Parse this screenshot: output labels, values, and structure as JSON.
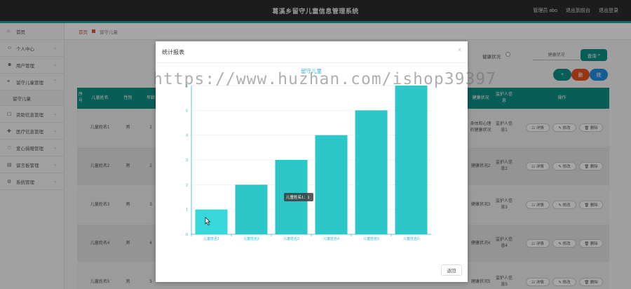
{
  "app": {
    "title": "葛溪乡留守儿童信息管理系统",
    "admin_label": "管理员 abo",
    "back_to_front": "退出到前台",
    "logout": "退出登录"
  },
  "sidebar": {
    "items": [
      {
        "label": "首页",
        "icon": "home-icon"
      },
      {
        "label": "个人中心",
        "icon": "user-icon"
      },
      {
        "label": "用户管理",
        "icon": "users-icon"
      },
      {
        "label": "留守儿童管理",
        "icon": "list-icon"
      },
      {
        "label": "留守儿童"
      },
      {
        "label": "资助信息管理",
        "icon": "doc-icon"
      },
      {
        "label": "医疗信息管理",
        "icon": "medical-icon"
      },
      {
        "label": "爱心捐赠管理",
        "icon": "heart-icon"
      },
      {
        "label": "留言板管理",
        "icon": "message-icon"
      },
      {
        "label": "系统管理",
        "icon": "gear-icon"
      }
    ]
  },
  "breadcrumb": {
    "home": "首页",
    "current": "留守儿童"
  },
  "search": {
    "label": "健康状况",
    "placeholder": "健康状况",
    "button": "查询"
  },
  "actions": {
    "add": "+",
    "delete": "删",
    "chart": "统"
  },
  "table": {
    "headers": [
      "序号",
      "儿童姓名",
      "性别",
      "年龄",
      "健康状况",
      "监护人信息",
      "操作"
    ],
    "rows": [
      {
        "index": "",
        "name": "儿童姓名1",
        "gender": "男",
        "age": "1",
        "health": "身体和心理的健康状况",
        "guardian": "监护人信息1"
      },
      {
        "index": "",
        "name": "儿童姓名2",
        "gender": "男",
        "age": "2",
        "health": "健康状况2",
        "guardian": "监护人信息2"
      },
      {
        "index": "",
        "name": "儿童姓名3",
        "gender": "男",
        "age": "3",
        "health": "健康状况3",
        "guardian": "监护人信息3"
      },
      {
        "index": "",
        "name": "儿童姓名4",
        "gender": "男",
        "age": "4",
        "health": "健康状况4",
        "guardian": "监护人信息4"
      },
      {
        "index": "",
        "name": "儿童姓名5",
        "gender": "男",
        "age": "5",
        "health": "健康状况5",
        "guardian": "监护人信息5"
      }
    ],
    "row_buttons": {
      "detail": "☷ 详情",
      "edit": "✎ 修改",
      "delete": "🗑 删除"
    }
  },
  "modal": {
    "title": "统计报表",
    "close": "×",
    "back_button": "返回"
  },
  "chart_data": {
    "type": "bar",
    "title": "留守儿童",
    "categories": [
      "儿童姓名1",
      "儿童姓名2",
      "儿童姓名3",
      "儿童姓名4",
      "儿童姓名5",
      "儿童姓名6"
    ],
    "values": [
      1,
      2,
      3,
      4,
      5,
      6
    ],
    "ylim": [
      0,
      6
    ],
    "yticks": [
      0,
      1,
      2,
      3,
      4,
      5,
      6
    ],
    "tooltip": "儿童姓名1：1",
    "colors": {
      "bar": "#2ec7c9",
      "bar_highlight": "#38d7d9",
      "axis": "#38b3d5"
    }
  },
  "watermark": "https://www.huzhan.com/ishop39397"
}
